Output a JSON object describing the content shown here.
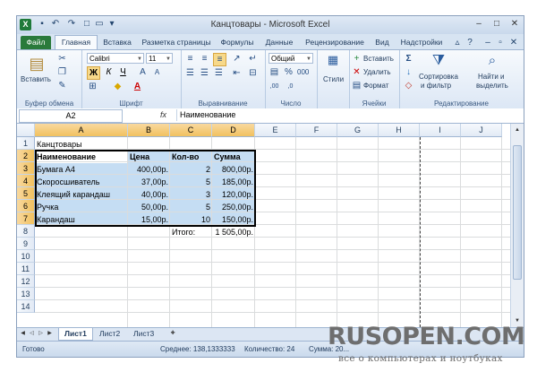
{
  "window": {
    "title": "Канцтовары - Microsoft Excel",
    "app_icon": "X"
  },
  "ribbon_tabs": [
    "Файл",
    "Главная",
    "Вставка",
    "Разметка страницы",
    "Формулы",
    "Данные",
    "Рецензирование",
    "Вид",
    "Надстройки"
  ],
  "ribbon": {
    "paste_label": "Вставить",
    "clipboard_group": "Буфер обмена",
    "font_name": "Calibri",
    "font_size": "11",
    "bold": "Ж",
    "italic": "К",
    "underline": "Ч",
    "font_group": "Шрифт",
    "alignment_group": "Выравнивание",
    "number_format": "Общий",
    "number_group": "Число",
    "styles_label": "Стили",
    "insert_label": "Вставить",
    "delete_label": "Удалить",
    "format_label": "Формат",
    "cells_group": "Ячейки",
    "sort_label_1": "Сортировка",
    "sort_label_2": "и фильтр",
    "find_label_1": "Найти и",
    "find_label_2": "выделить",
    "editing_group": "Редактирование"
  },
  "formula_bar": {
    "name_box": "A2",
    "fx": "fx",
    "value": "Наименование"
  },
  "columns": [
    "A",
    "B",
    "C",
    "D",
    "E",
    "F",
    "G",
    "H",
    "I",
    "J"
  ],
  "rows": [
    "1",
    "2",
    "3",
    "4",
    "5",
    "6",
    "7",
    "8",
    "9",
    "10",
    "11",
    "12",
    "13",
    "14"
  ],
  "sheet": {
    "title_cell": "Канцтовары",
    "headers": [
      "Наименование",
      "Цена",
      "Кол-во",
      "Сумма"
    ],
    "items": [
      {
        "name": "Бумага А4",
        "price": "400,00р.",
        "qty": "2",
        "sum": "800,00р."
      },
      {
        "name": "Скоросшиватель",
        "price": "37,00р.",
        "qty": "5",
        "sum": "185,00р."
      },
      {
        "name": "Клеящий карандаш",
        "price": "40,00р.",
        "qty": "3",
        "sum": "120,00р."
      },
      {
        "name": "Ручка",
        "price": "50,00р.",
        "qty": "5",
        "sum": "250,00р."
      },
      {
        "name": "Карандаш",
        "price": "15,00р.",
        "qty": "10",
        "sum": "150,00р."
      }
    ],
    "total_label": "Итого:",
    "total_value": "1 505,00р."
  },
  "sheet_tabs": [
    "Лист1",
    "Лист2",
    "Лист3"
  ],
  "status": {
    "ready": "Готово",
    "average": "Среднее: 138,1333333",
    "count": "Количество: 24",
    "sum": "Сумма: 20..."
  },
  "watermark": {
    "brand": "RUSOPEN.COM",
    "tagline": "все о компьютерах и ноутбуках"
  }
}
